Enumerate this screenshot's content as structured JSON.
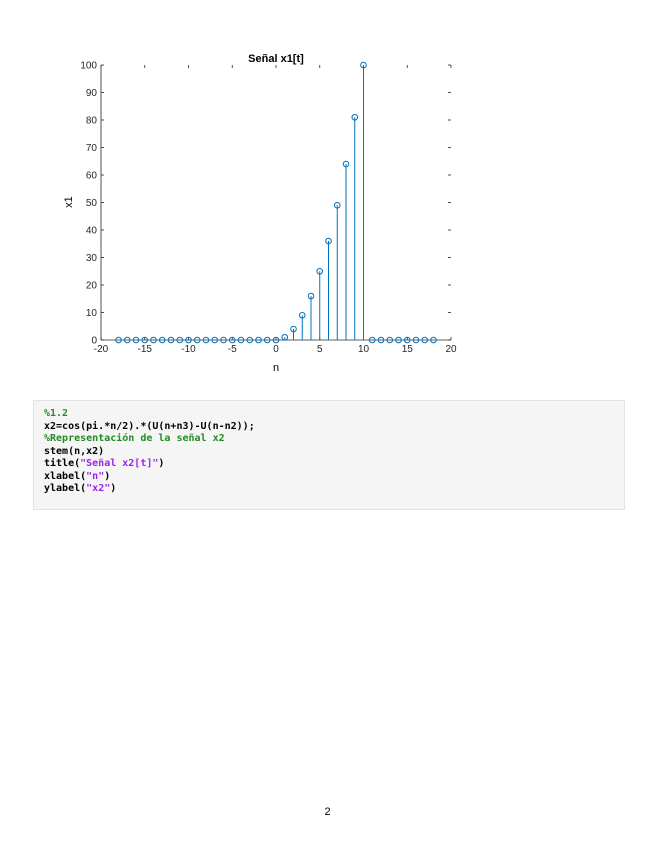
{
  "chart_data": {
    "type": "stem",
    "title": "Señal x1[t]",
    "xlabel": "n",
    "ylabel": "x1",
    "xlim": [
      -20,
      20
    ],
    "ylim": [
      0,
      100
    ],
    "xticks": [
      -20,
      -15,
      -10,
      -5,
      0,
      5,
      10,
      15,
      20
    ],
    "yticks": [
      0,
      10,
      20,
      30,
      40,
      50,
      60,
      70,
      80,
      90,
      100
    ],
    "color": "#0072bd",
    "x": [
      -18,
      -17,
      -16,
      -15,
      -14,
      -13,
      -12,
      -11,
      -10,
      -9,
      -8,
      -7,
      -6,
      -5,
      -4,
      -3,
      -2,
      -1,
      0,
      1,
      2,
      3,
      4,
      5,
      6,
      7,
      8,
      9,
      10,
      11,
      12,
      13,
      14,
      15,
      16,
      17,
      18
    ],
    "y": [
      0,
      0,
      0,
      0,
      0,
      0,
      0,
      0,
      0,
      0,
      0,
      0,
      0,
      0,
      0,
      0,
      0,
      0,
      0,
      1,
      4,
      9,
      16,
      25,
      36,
      49,
      64,
      81,
      100,
      0,
      0,
      0,
      0,
      0,
      0,
      0,
      0
    ]
  },
  "code": {
    "lines": [
      [
        {
          "t": "%1.2",
          "c": "cm"
        }
      ],
      [
        {
          "t": "x2=cos(pi.*n/2).*(U(n+n3)-U(n-n2));",
          "c": ""
        }
      ],
      [
        {
          "t": "%Representación de la señal x2",
          "c": "cm"
        }
      ],
      [
        {
          "t": "stem(n,x2)",
          "c": ""
        }
      ],
      [
        {
          "t": "title(",
          "c": ""
        },
        {
          "t": "\"Señal x2[t]\"",
          "c": "st"
        },
        {
          "t": ")",
          "c": ""
        }
      ],
      [
        {
          "t": "xlabel(",
          "c": ""
        },
        {
          "t": "\"n\"",
          "c": "st"
        },
        {
          "t": ")",
          "c": ""
        }
      ],
      [
        {
          "t": "ylabel(",
          "c": ""
        },
        {
          "t": "\"x2\"",
          "c": "st"
        },
        {
          "t": ")",
          "c": ""
        }
      ]
    ]
  },
  "page_number": "2"
}
